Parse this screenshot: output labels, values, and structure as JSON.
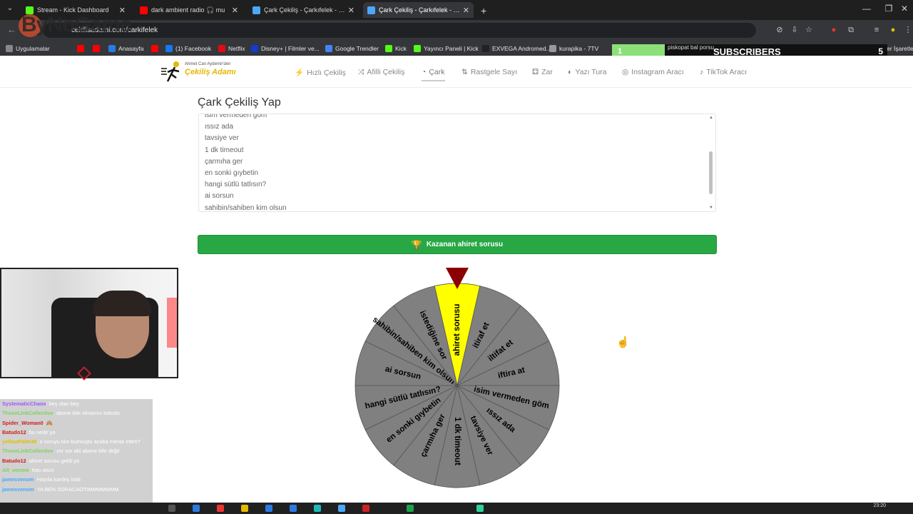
{
  "browser": {
    "tabs": [
      {
        "title": "Stream - Kick Dashboard",
        "color": "#53fc18",
        "active": false
      },
      {
        "title": "dark ambient radio 🎧 mu",
        "color": "#ff0000",
        "active": false
      },
      {
        "title": "Çark Çekiliş - Çarkıfelek - Hızlı Ç",
        "color": "#4aa8ff",
        "active": false
      },
      {
        "title": "Çark Çekiliş - Çarkıfelek - Hızlı Ç",
        "color": "#4aa8ff",
        "active": true
      }
    ],
    "new_tab": "+",
    "address": "cekilisadami.com/carkifelek",
    "watermark": "ByNoGame",
    "bookmarks": [
      "Uygulamalar",
      "Anasayfa",
      "(1) Facebook",
      "Netflix",
      "Disney+ | Filmler ve...",
      "Google Trendler",
      "Kick",
      "Yayıncı Paneli | Kick",
      "EXVEGA Andromed...",
      "kurapika - 7TV",
      "piskopat bal porsu..."
    ],
    "other_bookmarks": "Tüm Yer İşaretleri"
  },
  "overlay": {
    "subs_count": "1",
    "subs_label": "SUBSCRIBERS",
    "subs_goal": "5",
    "subs_progress": 0.2
  },
  "site": {
    "logo_top": "Ahmet Can Aydemir'den",
    "logo_main": "Çekiliş Adamı",
    "nav": [
      {
        "label": "Hızlı Çekiliş",
        "icon": "bolt-icon",
        "glyph": "⚡",
        "active": false
      },
      {
        "label": "Afilli Çekiliş",
        "icon": "shuffle-icon",
        "glyph": "⤨",
        "active": false
      },
      {
        "label": "Çark",
        "icon": "pie-icon",
        "glyph": "◔",
        "active": true
      },
      {
        "label": "Rastgele Sayı",
        "icon": "sort-icon",
        "glyph": "⇅",
        "active": false
      },
      {
        "label": "Zar",
        "icon": "dice-icon",
        "glyph": "⚃",
        "active": false
      },
      {
        "label": "Yazı Tura",
        "icon": "coin-icon",
        "glyph": "◐",
        "active": false
      },
      {
        "label": "Instagram Aracı",
        "icon": "instagram-icon",
        "glyph": "◎",
        "active": false
      },
      {
        "label": "TikTok Aracı",
        "icon": "tiktok-icon",
        "glyph": "♪",
        "active": false
      }
    ]
  },
  "main": {
    "title": "Çark Çekiliş Yap",
    "entries": [
      "isim vermeden göm",
      "ıssız ada",
      "tavsiye ver",
      "1 dk timeout",
      "çarmıha ger",
      "en sonki gıybetin",
      "hangi sütlü tatlısın?",
      "ai sorsun",
      "sahibin/sahiben kim olsun"
    ],
    "winner_button": "Kazanan ahiret sorusu",
    "wheel": {
      "winner_color": "#ffff00",
      "base_color": "#808080",
      "pointer_color": "#8b0000",
      "segments": [
        "ahiret sorusu",
        "itiraf et",
        "iltifat et",
        "iftira at",
        "isim vermeden göm",
        "ıssız ada",
        "tavsiye ver",
        "1 dk timeout",
        "çarmıha ger",
        "en sonki gıybetin",
        "hangi sütlü tatlısın?",
        "ai sorsun",
        "sahibin/sahiben kim olsun",
        "istediğine sor"
      ]
    }
  },
  "chat": [
    {
      "user": "SystematicChaos",
      "msg": ": beş olan beş",
      "color": "#9b59ff"
    },
    {
      "user": "ThoseLinkCollective",
      "msg": ": abone bile olmamız batudo",
      "color": "#7dd35f"
    },
    {
      "user": "Spider_Woman0",
      "msg": ": 🙈",
      "color": "#d02020"
    },
    {
      "user": "Batudo12",
      "msg": ": bu nedir ya",
      "color": "#d02020"
    },
    {
      "user": "yellowPalm49",
      "msg": ": o soruyu kim bulmuştu acaba merak ettim?",
      "color": "#e0c000"
    },
    {
      "user": "ThoseLinkCollective",
      "msg": ": zor sor abi abone bile değil",
      "color": "#7dd35f"
    },
    {
      "user": "Batudo12",
      "msg": ": ahiret sorusu geldi ya",
      "color": "#d02020"
    },
    {
      "user": "Alt_venom",
      "msg": ": foto atsın",
      "color": "#7dd35f"
    },
    {
      "user": "jamesvenom",
      "msg": ": Hayda kardeş katlı",
      "color": "#4aa8ff"
    },
    {
      "user": "jamesvenom",
      "msg": ": YA BEN SORACAOTIMMMMMMM",
      "color": "#4aa8ff"
    }
  ],
  "taskbar": {
    "clock": "23:20"
  }
}
